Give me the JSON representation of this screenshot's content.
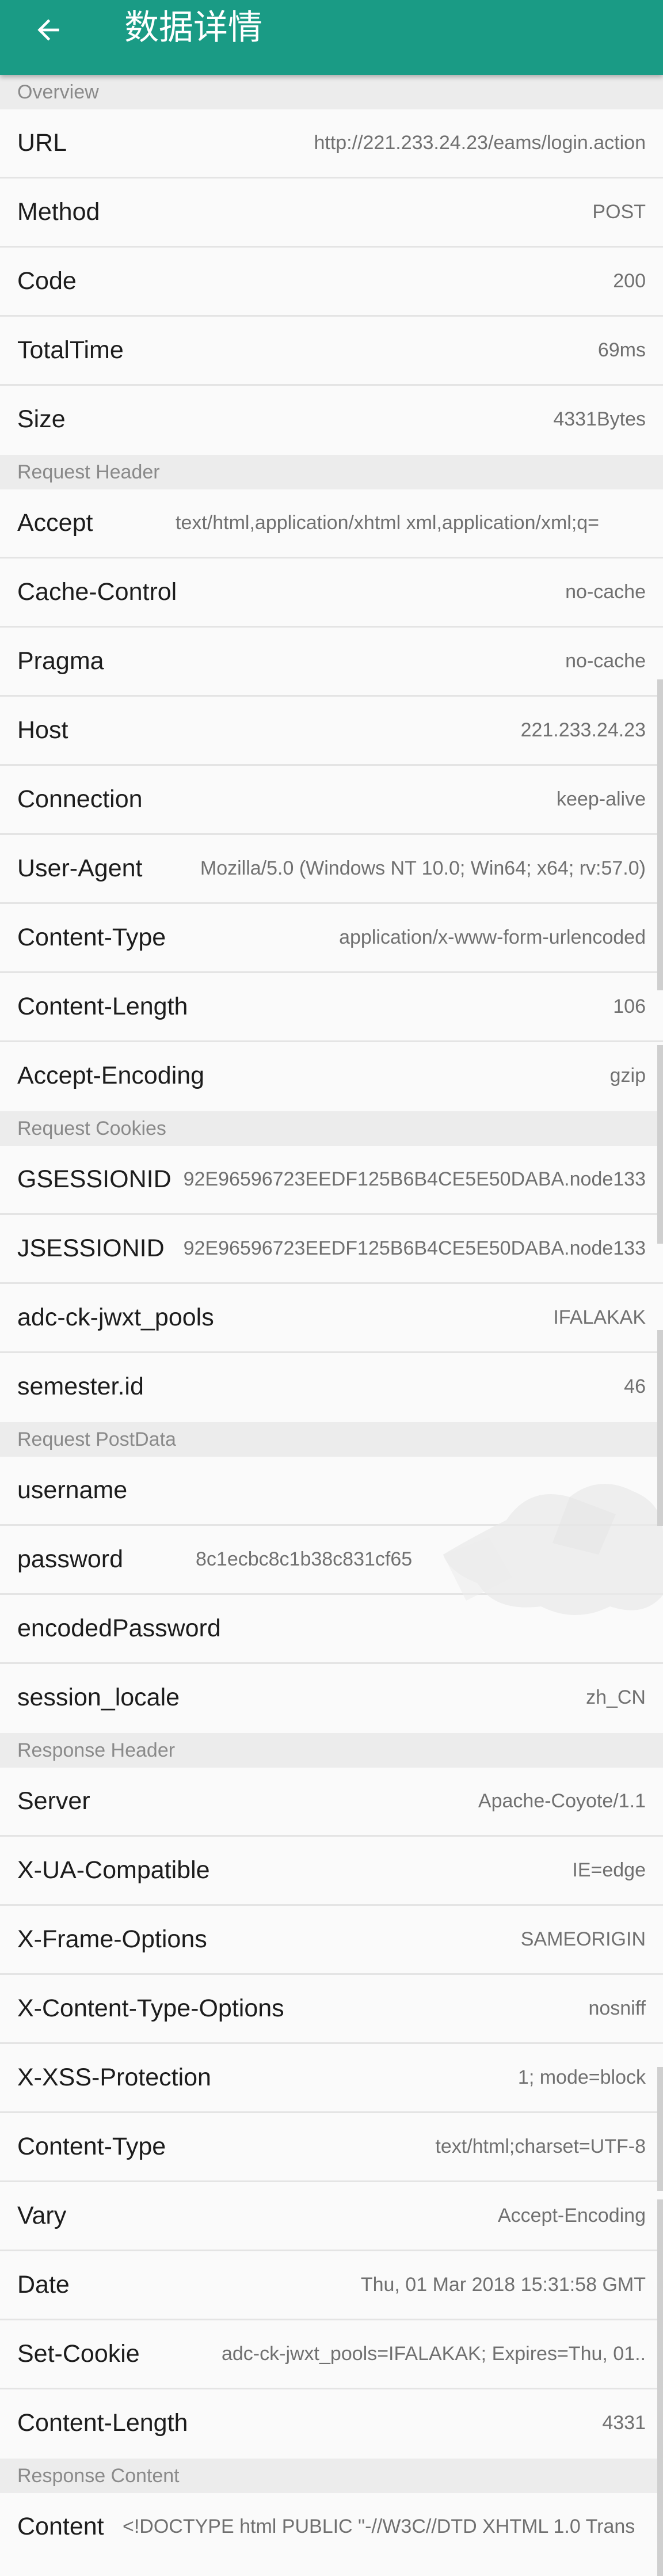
{
  "appbar": {
    "title": "数据详情",
    "back_icon": "back-arrow-icon",
    "color": "#1a9b85"
  },
  "sections": [
    {
      "title": "Overview",
      "rows": [
        {
          "key": "URL",
          "value": "http://221.233.24.23/eams/login.action"
        },
        {
          "key": "Method",
          "value": "POST"
        },
        {
          "key": "Code",
          "value": "200"
        },
        {
          "key": "TotalTime",
          "value": "69ms"
        },
        {
          "key": "Size",
          "value": "4331Bytes"
        }
      ]
    },
    {
      "title": "Request Header",
      "rows": [
        {
          "key": "Accept",
          "value": "text/html,application/xhtml xml,application/xml;q="
        },
        {
          "key": "Cache-Control",
          "value": "no-cache"
        },
        {
          "key": "Pragma",
          "value": "no-cache"
        },
        {
          "key": "Host",
          "value": "221.233.24.23"
        },
        {
          "key": "Connection",
          "value": "keep-alive"
        },
        {
          "key": "User-Agent",
          "value": "Mozilla/5.0 (Windows NT 10.0; Win64; x64; rv:57.0)"
        },
        {
          "key": "Content-Type",
          "value": "application/x-www-form-urlencoded"
        },
        {
          "key": "Content-Length",
          "value": "106"
        },
        {
          "key": "Accept-Encoding",
          "value": "gzip"
        }
      ]
    },
    {
      "title": "Request Cookies",
      "rows": [
        {
          "key": "GSESSIONID",
          "value": "92E96596723EEDF125B6B4CE5E50DABA.node133"
        },
        {
          "key": "JSESSIONID",
          "value": "92E96596723EEDF125B6B4CE5E50DABA.node133"
        },
        {
          "key": "adc-ck-jwxt_pools",
          "value": "IFALAKAK"
        },
        {
          "key": "semester.id",
          "value": "46"
        }
      ]
    },
    {
      "title": "Request PostData",
      "rows": [
        {
          "key": "username",
          "value": ""
        },
        {
          "key": "password",
          "value": "8c1ecbc8c1b38c831cf65"
        },
        {
          "key": "encodedPassword",
          "value": ""
        },
        {
          "key": "session_locale",
          "value": "zh_CN"
        }
      ]
    },
    {
      "title": "Response Header",
      "rows": [
        {
          "key": "Server",
          "value": "Apache-Coyote/1.1"
        },
        {
          "key": "X-UA-Compatible",
          "value": "IE=edge"
        },
        {
          "key": "X-Frame-Options",
          "value": "SAMEORIGIN"
        },
        {
          "key": "X-Content-Type-Options",
          "value": "nosniff"
        },
        {
          "key": "X-XSS-Protection",
          "value": "1; mode=block"
        },
        {
          "key": "Content-Type",
          "value": "text/html;charset=UTF-8"
        },
        {
          "key": "Vary",
          "value": "Accept-Encoding"
        },
        {
          "key": "Date",
          "value": "Thu, 01 Mar 2018 15:31:58 GMT"
        },
        {
          "key": "Set-Cookie",
          "value": "adc-ck-jwxt_pools=IFALAKAK; Expires=Thu, 01.."
        },
        {
          "key": "Content-Length",
          "value": "4331"
        }
      ]
    },
    {
      "title": "Response Content",
      "rows": [
        {
          "key": "Content",
          "value": "<!DOCTYPE html PUBLIC \"-//W3C//DTD XHTML 1.0 Trans"
        }
      ]
    }
  ]
}
